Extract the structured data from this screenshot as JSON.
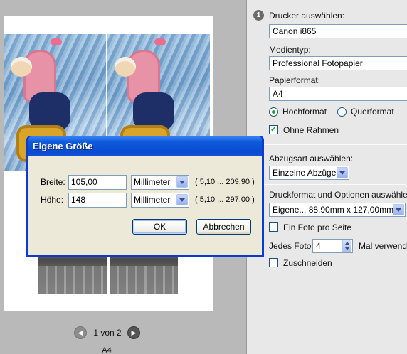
{
  "preview": {
    "pager": {
      "label": "1 von 2",
      "prev_symbol": "◀",
      "next_symbol": "▶"
    },
    "paper_size": "A4"
  },
  "panel": {
    "step_number": "1",
    "printer": {
      "label": "Drucker auswählen:",
      "value": "Canon i865"
    },
    "media": {
      "label": "Medientyp:",
      "value": "Professional Fotopapier"
    },
    "paper_format": {
      "label": "Papierformat:",
      "value": "A4"
    },
    "orientation": {
      "portrait": "Hochformat",
      "landscape": "Querformat",
      "selected": "portrait"
    },
    "borderless": {
      "label": "Ohne Rahmen",
      "checked": true
    },
    "print_type": {
      "label": "Abzugsart auswählen:",
      "value": "Einzelne Abzüge"
    },
    "print_format": {
      "label": "Druckformat und Optionen auswähle",
      "value": "Eigene... 88,90mm x 127,00mm"
    },
    "one_photo_per_page": {
      "label": "Ein Foto pro Seite",
      "checked": false
    },
    "each_photo": {
      "label": "Jedes Foto",
      "value": "4",
      "suffix": "Mal verwendi"
    },
    "crop": {
      "label": "Zuschneiden",
      "checked": false
    }
  },
  "dialog": {
    "title": "Eigene Größe",
    "width": {
      "label": "Breite:",
      "value": "105,00",
      "unit": "Millimeter",
      "range": "( 5,10 ... 209,90 )"
    },
    "height": {
      "label": "Höhe:",
      "value": "148",
      "unit": "Millimeter",
      "range": "( 5,10 ... 297,00 )"
    },
    "ok_label": "OK",
    "cancel_label": "Abbrechen"
  },
  "colors": {
    "titlebar": "#0a4bd0",
    "accent_green": "#21a121",
    "dialog_bg": "#ece9d8"
  }
}
